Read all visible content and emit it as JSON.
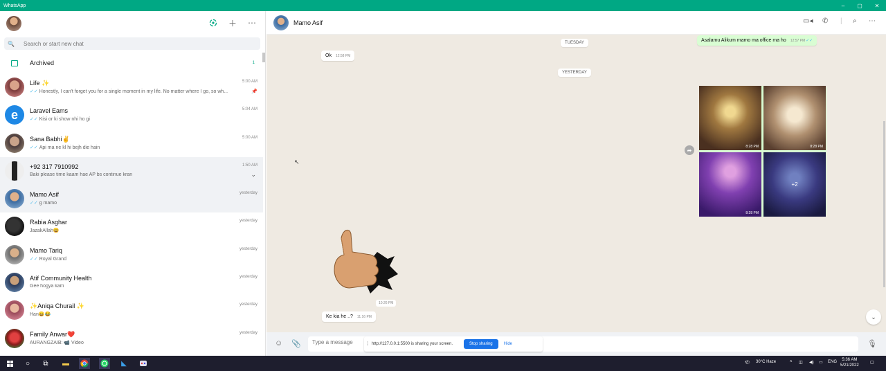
{
  "titlebar": {
    "title": "WhatsApp",
    "minimize": "–",
    "maximize": "▢",
    "close": "✕"
  },
  "sidebar": {
    "search_placeholder": "Search or start new chat",
    "archived": {
      "label": "Archived",
      "count": "1"
    },
    "chats": [
      {
        "name": "Life ✨",
        "time": "5:00 AM",
        "message": "Honestly, I can't forget you for a single moment in my life. No matter where I go, so wh...",
        "tick": "✓✓",
        "pinned": true
      },
      {
        "name": "Laravel Eams",
        "time": "5:04 AM",
        "message": "Kisi or ki show nhi ho gi",
        "tick": "✓✓"
      },
      {
        "name": "Sana Babhi✌",
        "time": "5:00 AM",
        "message": "Api ma ne kl hi bejh die hain",
        "tick": "✓✓"
      },
      {
        "name": "+92 317 7910992",
        "time": "1:50 AM",
        "message": "Baki please time kaam hae AP bs continue kran",
        "tick": ""
      },
      {
        "name": "Mamo Asif",
        "time": "yesterday",
        "message": "g mamo",
        "tick": "✓✓"
      },
      {
        "name": "Rabia Asghar",
        "time": "yesterday",
        "message": "JazakAllah😄",
        "tick": ""
      },
      {
        "name": "Mamo Tariq",
        "time": "yesterday",
        "message": "Royal Grand",
        "tick": "✓✓"
      },
      {
        "name": "Atif Community Health",
        "time": "yesterday",
        "message": "Gee hogya kam",
        "tick": ""
      },
      {
        "name": "✨Aniqa Churail ✨",
        "time": "yesterday",
        "message": "Han😄😂",
        "tick": ""
      },
      {
        "name": "Family Anwar❤️",
        "time": "yesterday",
        "message": "AURANGZAIB: 📹 Video",
        "tick": ""
      }
    ]
  },
  "chat": {
    "contact_name": "Mamo Asif",
    "day_tuesday": "TUESDAY",
    "day_yesterday": "YESTERDAY",
    "msg_out_1": {
      "text": "Asalamu Alikum mamo ma office ma ho",
      "time": "12:57 PM",
      "tick": "✓✓"
    },
    "msg_in_1": {
      "text": "Ok",
      "time": "12:58 PM"
    },
    "photos": [
      {
        "time": "8:28 PM"
      },
      {
        "time": "8:28 PM"
      },
      {
        "time": "8:28 PM"
      },
      {
        "more": "+2"
      }
    ],
    "sticker_time": "10:26 PM",
    "msg_in_2": {
      "text": "Ke kia he ..?",
      "time": "11:16 PM"
    }
  },
  "footer": {
    "message_placeholder": "Type a message",
    "share_text": "http://127.0.0.1:5500 is sharing your screen.",
    "stop_sharing": "Stop sharing",
    "hide": "Hide"
  },
  "taskbar": {
    "weather": "30°C  Haze",
    "lang": "ENG",
    "time": "5:36 AM",
    "date": "5/21/2022"
  },
  "colors": {
    "accent": "#00a884",
    "bubble_out": "#d9fdd3",
    "chat_bg": "#efeae2",
    "tick": "#53bdeb"
  }
}
